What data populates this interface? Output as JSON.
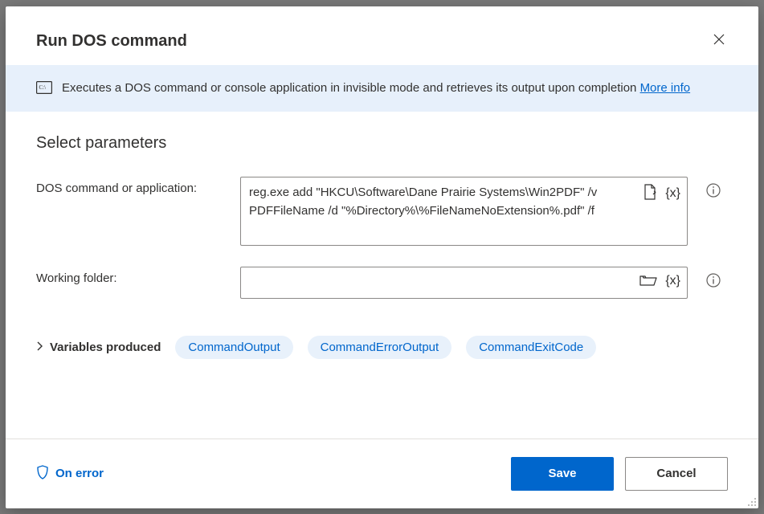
{
  "header": {
    "title": "Run DOS command"
  },
  "infoBar": {
    "text": "Executes a DOS command or console application in invisible mode and retrieves its output upon completion",
    "linkText": "More info"
  },
  "section": {
    "title": "Select parameters"
  },
  "fields": {
    "command": {
      "label": "DOS command or application:",
      "value": "reg.exe add \"HKCU\\Software\\Dane Prairie Systems\\Win2PDF\" /v PDFFileName /d \"%Directory%\\%FileNameNoExtension%.pdf\" /f"
    },
    "workingFolder": {
      "label": "Working folder:",
      "value": ""
    },
    "varToken": "{x}"
  },
  "variables": {
    "label": "Variables produced",
    "items": [
      "CommandOutput",
      "CommandErrorOutput",
      "CommandExitCode"
    ]
  },
  "footer": {
    "onError": "On error",
    "save": "Save",
    "cancel": "Cancel"
  }
}
